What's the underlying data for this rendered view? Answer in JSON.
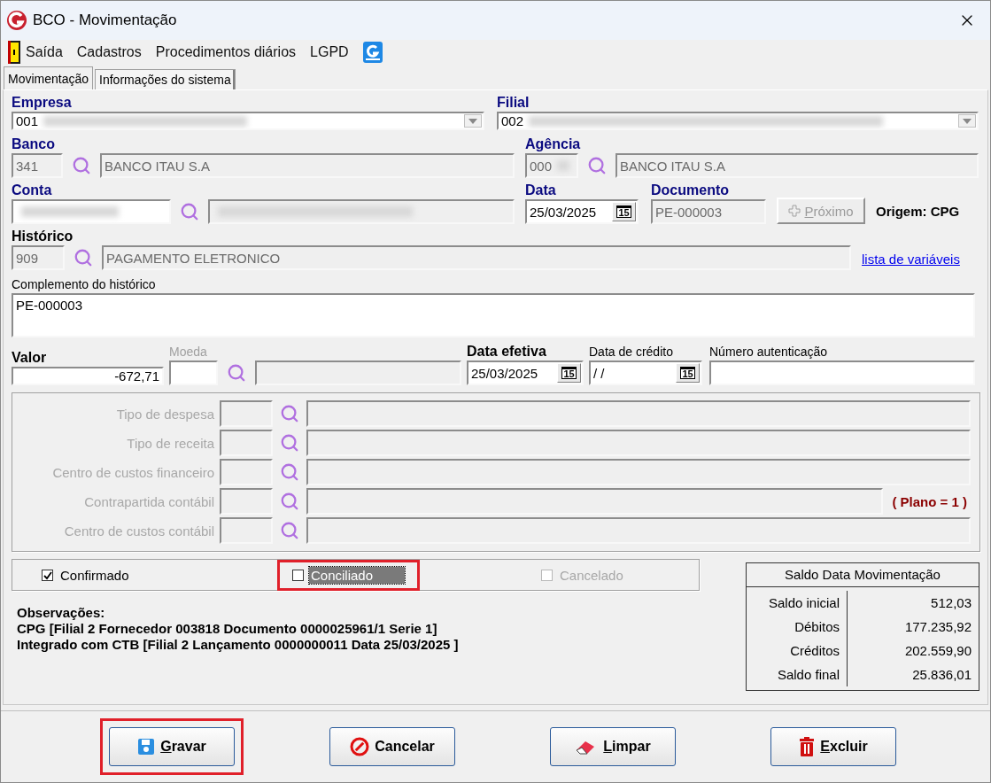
{
  "window": {
    "title": "BCO - Movimentação"
  },
  "menu": [
    {
      "kind": "exit",
      "label": "Saída"
    },
    {
      "kind": "text",
      "label": "Cadastros"
    },
    {
      "kind": "text",
      "label": "Procedimentos diários"
    },
    {
      "kind": "text",
      "label": "LGPD"
    },
    {
      "kind": "logo"
    }
  ],
  "tabs": [
    {
      "label": "Movimentação",
      "selected": true
    },
    {
      "label": "Informações do sistema",
      "selected": false
    }
  ],
  "empresa": {
    "label": {
      "text": "Empresa",
      "kind": "required"
    },
    "value": "001",
    "redacted": true
  },
  "filial": {
    "label": {
      "text": "Filial",
      "kind": "required"
    },
    "value": "002",
    "redacted": true
  },
  "banco": {
    "label": {
      "text": "Banco",
      "kind": "required"
    },
    "code": "341",
    "name": "BANCO ITAU S.A"
  },
  "agencia": {
    "label": {
      "text": "Agência",
      "kind": "required"
    },
    "code": "000",
    "name": "BANCO ITAU S.A",
    "redacted": true
  },
  "conta": {
    "label": {
      "text": "Conta",
      "kind": "required"
    },
    "redacted": true
  },
  "data": {
    "label": {
      "text": "Data",
      "kind": "required"
    },
    "value": "25/03/2025",
    "calendar_glyph": "15"
  },
  "documento": {
    "label": {
      "text": "Documento",
      "kind": "required"
    },
    "value": "PE-000003"
  },
  "proximo_button": {
    "label": "Próximo",
    "disabled": true
  },
  "origem": "Origem: CPG",
  "historico": {
    "label": {
      "text": "Histórico",
      "kind": "bold"
    },
    "code": "909",
    "name": "PAGAMENTO ELETRONICO"
  },
  "variables_link": "lista de variáveis",
  "complemento": {
    "label": {
      "text": "Complemento do histórico",
      "kind": "plain"
    },
    "value": "PE-000003"
  },
  "valor": {
    "label": {
      "text": "Valor",
      "kind": "bold"
    },
    "value": "-672,71"
  },
  "moeda": {
    "label": {
      "text": "Moeda",
      "kind": "disabled"
    }
  },
  "data_efetiva": {
    "label": {
      "text": "Data efetiva",
      "kind": "bold"
    },
    "value": "25/03/2025",
    "calendar_glyph": "15"
  },
  "data_credito": {
    "label": {
      "text": "Data de crédito",
      "kind": "plain"
    },
    "value": "/ /",
    "calendar_glyph": "15"
  },
  "numero_autenticacao": {
    "label": {
      "text": "Número autenticação",
      "kind": "plain"
    }
  },
  "classification": {
    "disabled": true,
    "rows": [
      {
        "label": "Tipo de despesa"
      },
      {
        "label": "Tipo de receita"
      },
      {
        "label": "Centro de custos financeiro"
      },
      {
        "label": "Contrapartida contábil",
        "note": "( Plano = 1 )"
      },
      {
        "label": "Centro de custos contábil"
      }
    ]
  },
  "status_checks": [
    {
      "label": "Confirmado",
      "checked": true,
      "disabled": false,
      "highlighted": false,
      "focused": false
    },
    {
      "label": "Conciliado",
      "checked": false,
      "disabled": false,
      "highlighted": true,
      "focused": true
    },
    {
      "label": "Cancelado",
      "checked": false,
      "disabled": true,
      "highlighted": false,
      "focused": false
    }
  ],
  "observacoes": {
    "title": "Observações:",
    "lines": [
      "CPG [Filial 2 Fornecedor 003818 Documento 0000025961/1 Serie 1]",
      "Integrado com CTB [Filial 2 Lançamento 0000000011 Data  25/03/2025 ]"
    ]
  },
  "saldo": {
    "title": "Saldo Data Movimentação",
    "rows": [
      {
        "label": "Saldo inicial",
        "value": "512,03"
      },
      {
        "label": "Débitos",
        "value": "177.235,92"
      },
      {
        "label": "Créditos",
        "value": "202.559,90"
      },
      {
        "label": "Saldo final",
        "value": "25.836,01"
      }
    ]
  },
  "buttons": [
    {
      "kind": "save",
      "label": "Gravar",
      "highlighted": true,
      "mnemonic": true
    },
    {
      "kind": "cancel",
      "label": "Cancelar",
      "highlighted": false,
      "mnemonic": false
    },
    {
      "kind": "clear",
      "label": "Limpar",
      "highlighted": false,
      "mnemonic": true
    },
    {
      "kind": "delete",
      "label": "Excluir",
      "highlighted": false,
      "mnemonic": true
    }
  ]
}
